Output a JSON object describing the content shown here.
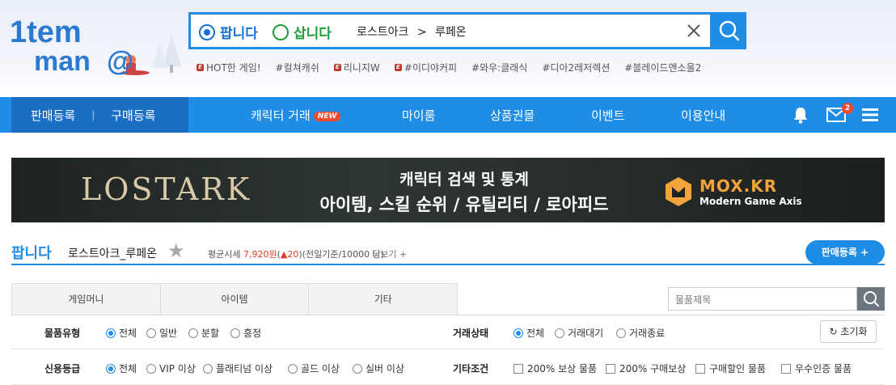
{
  "header": {
    "logo_text_top": "item",
    "logo_text_bottom": "mania",
    "search": {
      "sell_label": "팝니다",
      "buy_label": "삽니다",
      "query_game": "로스트아크",
      "query_sep": ">",
      "query_server": "루페온",
      "clear_icon": "close-icon",
      "search_icon": "search-icon"
    },
    "hot_tags": [
      {
        "label": "HOT한 게임!",
        "e": true
      },
      {
        "label": "#컬쳐캐쉬",
        "e": false
      },
      {
        "label": "리니지W",
        "e": true
      },
      {
        "label": "#이디야커피",
        "e": true
      },
      {
        "label": "#와우:클래식",
        "e": false
      },
      {
        "label": "#디아2레저렉션",
        "e": false
      },
      {
        "label": "#블레이드앤소울2",
        "e": false
      }
    ]
  },
  "nav": {
    "sell_register": "판매등록",
    "divider": "|",
    "buy_register": "구매등록",
    "items": [
      "캐릭터 거래",
      "마이룸",
      "상품권몰",
      "이벤트",
      "이용안내"
    ],
    "new_badge": "NEW",
    "mail_count": "2",
    "icons": [
      "bell-icon",
      "mail-icon",
      "menu-icon"
    ]
  },
  "banner": {
    "game_logo": "LOSTARK",
    "line1": "캐릭터 검색 및 통계",
    "line2": "아이템, 스킬 순위 / 유틸리티 / 로아피드",
    "brand_title": "MOX.KR",
    "brand_sub": "Modern Game Axis"
  },
  "section": {
    "title": "팝니다",
    "game": "로스트아크_루페온",
    "avg_label": "평균시세",
    "avg_value": "7,920원",
    "avg_change": "20",
    "avg_note": "(전일기준/10000 당)",
    "more": "더보기 +",
    "sell_button": "판매등록 +"
  },
  "tabs": [
    "게임머니",
    "아이템",
    "기타"
  ],
  "item_search_placeholder": "물품제목",
  "filters": {
    "type_label": "물품유형",
    "type_options": [
      "전체",
      "일반",
      "분할",
      "흥정"
    ],
    "status_label": "거래상태",
    "status_options": [
      "전체",
      "거래대기",
      "거래종료"
    ],
    "reset": "초기화",
    "credit_label": "신용등급",
    "credit_options": [
      "전체",
      "VIP 이상",
      "플래티넘 이상",
      "골드 이상",
      "실버 이상"
    ],
    "etc_label": "기타조건",
    "etc_options": [
      "200% 보상 물품",
      "200% 구매보상",
      "구매할인 물품",
      "우수인증 물품"
    ]
  },
  "colors": {
    "brand_blue": "#1f8ce6",
    "nav_dark": "#1a6fc4",
    "buy_green": "#1e9e3a",
    "alert_red": "#e43b2c"
  }
}
